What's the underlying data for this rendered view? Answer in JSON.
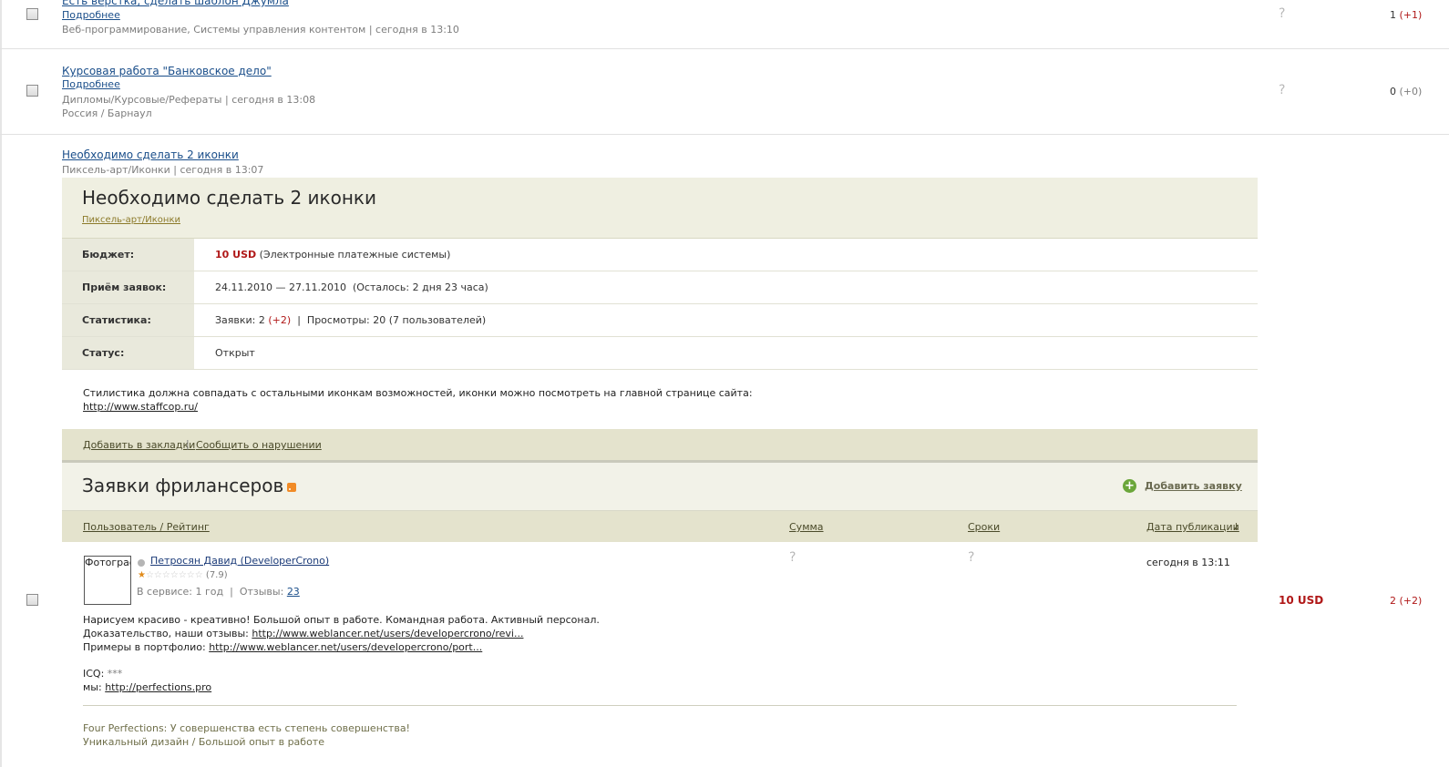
{
  "listing": [
    {
      "title": "Есть верстка, сделать шаблон Джумла",
      "more": "Подробнее",
      "meta": "Веб-программирование, Системы управления контентом | сегодня в 13:10",
      "question": "?",
      "count_main": "1",
      "count_delta": "(+1)"
    },
    {
      "title": "Курсовая работа \"Банковское дело\"",
      "more": "Подробнее",
      "meta": "Дипломы/Курсовые/Рефераты | сегодня в 13:08",
      "location": "Россия / Барнаул",
      "question": "?",
      "count_main": "0",
      "count_delta": "(+0)"
    },
    {
      "title": "Необходимо сделать 2 иконки",
      "meta": "Пиксель-арт/Иконки | сегодня в 13:07"
    }
  ],
  "project": {
    "title": "Необходимо сделать 2 иконки",
    "category": "Пиксель-арт/Иконки",
    "rows": {
      "budget_label": "Бюджет:",
      "budget_amount": "10 USD",
      "budget_note": "(Электронные платежные системы)",
      "accept_label": "Приём заявок:",
      "accept_value": "24.11.2010 — 27.11.2010  (Осталось: 2 дня 23 часа)",
      "stats_label": "Статистика:",
      "stats_bids": "Заявки: 2",
      "stats_bids_delta": "(+2)",
      "stats_sep": "|",
      "stats_views": "Просмотры: 20 (7 пользователей)",
      "status_label": "Статус:",
      "status_value": "Открыт"
    },
    "description": "Стилистика должна совпадать с остальными иконкам возможностей, иконки можно посмотреть на главной странице сайта:",
    "description_link": "http://www.staffcop.ru/",
    "actions": {
      "bookmark": "Добавить в закладки",
      "sep": "|",
      "report": "Сообщить о нарушении"
    }
  },
  "applications": {
    "title": "Заявки фрилансеров",
    "add_label": "Добавить заявку",
    "columns": {
      "user": "Пользователь / Рейтинг",
      "sum": "Сумма",
      "term": "Сроки",
      "date": "Дата публикации",
      "sort_arrow": "↓"
    },
    "items": [
      {
        "photo_alt": "Фотограф",
        "user": "Петросян Давид (DeveloperCrono)",
        "stars": "☆☆☆☆☆☆☆",
        "rating": "(7.9)",
        "service": "В сервисе: 1 год",
        "sep": "|",
        "reviews_label": "Отзывы:",
        "reviews_count": "23",
        "sum": "?",
        "term": "?",
        "date": "сегодня в 13:11",
        "text_line1": "Нарисуем красиво - креативно! Большой опыт в работе. Командная работа. Активный персонал.",
        "text_line2_prefix": "Доказательство, наши отзывы:",
        "text_line2_link": "http://www.weblancer.net/users/developercrono/revi...",
        "text_line3_prefix": "Примеры в портфолио:",
        "text_line3_link": "http://www.weblancer.net/users/developercrono/port...",
        "icq_label": "ICQ:",
        "icq_value": "***",
        "site_label": "мы:",
        "site_link": "http://perfections.pro",
        "signature_line1": "Four Perfections: У совершенства есть степень совершенства!",
        "signature_line2": "Уникальный дизайн / Большой опыт в работе"
      }
    ],
    "right_budget": "10 USD",
    "right_count_main": "2",
    "right_count_delta": "(+2)"
  },
  "colors": {
    "link_blue": "#1a4e8a",
    "panel_bg": "#efefe1",
    "bar_bg": "#e4e3cd",
    "accent_red": "#b01818",
    "add_green": "#6ba63a"
  }
}
